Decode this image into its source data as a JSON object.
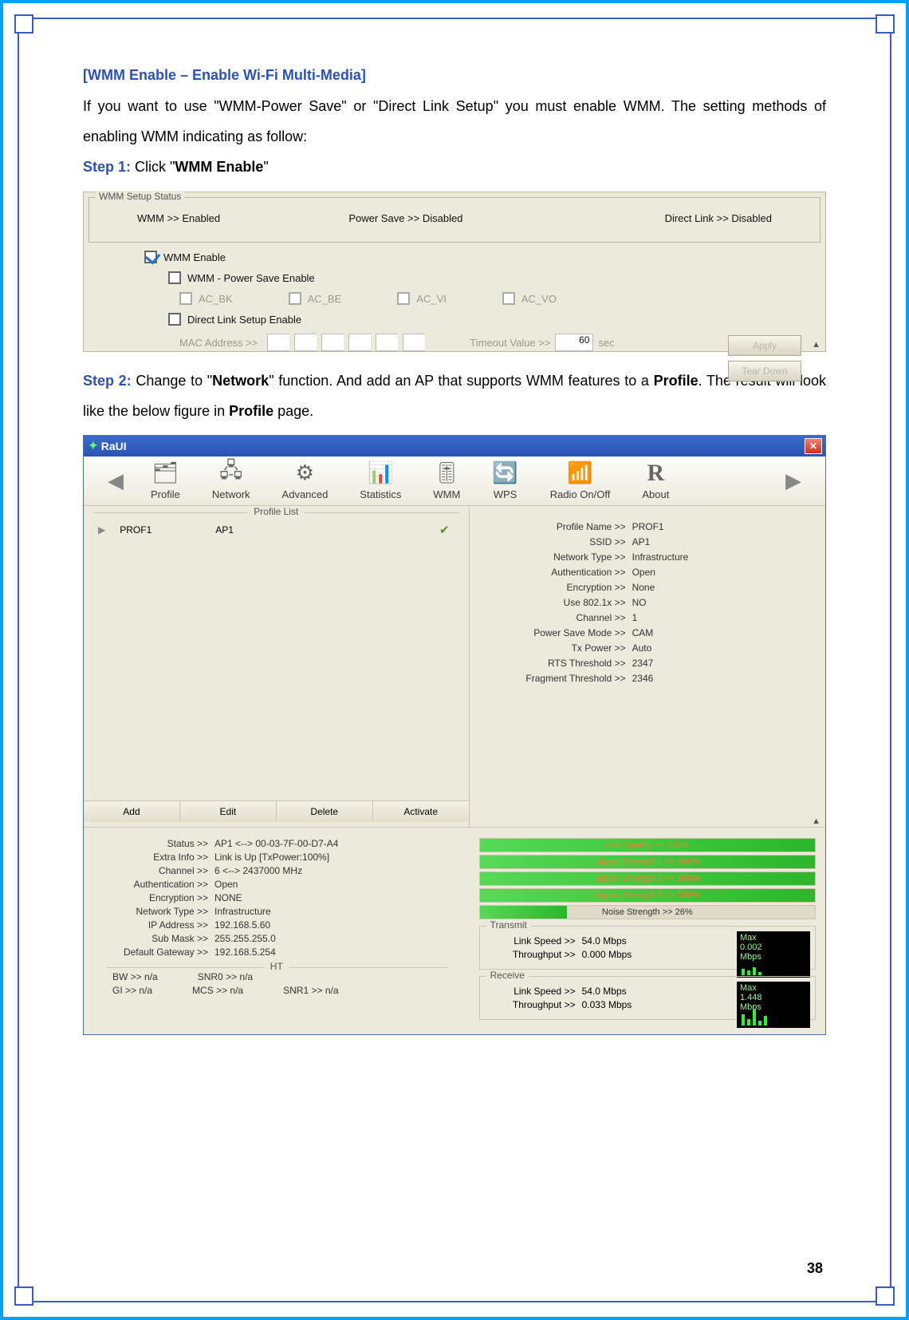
{
  "page_number": "38",
  "title": "[WMM Enable – Enable Wi-Fi Multi-Media]",
  "intro": "If you want to use \"WMM-Power Save\" or \"Direct Link Setup\" you must enable WMM. The setting methods of enabling WMM indicating as follow:",
  "step1_label": "Step 1: ",
  "step1_pre": "Click \"",
  "step1_bold": "WMM Enable",
  "step1_post": "\"",
  "step2_label": "Step 2: ",
  "step2_pre": "Change to \"",
  "step2_bold1": "Network",
  "step2_mid": "\" function. And add an AP that supports WMM features to a ",
  "step2_bold2": "Profile",
  "step2_mid2": ". The result will look like the below figure in ",
  "step2_bold3": "Profile",
  "step2_post": " page.",
  "wmm_panel": {
    "legend": "WMM Setup Status",
    "status_wmm": "WMM >>  Enabled",
    "status_power": "Power Save >>  Disabled",
    "status_dls": "Direct Link >>  Disabled",
    "cb_wmm": "WMM Enable",
    "cb_power": "WMM - Power Save Enable",
    "ac_bk": "AC_BK",
    "ac_be": "AC_BE",
    "ac_vi": "AC_VI",
    "ac_vo": "AC_VO",
    "cb_dls": "Direct Link Setup Enable",
    "mac_label": "MAC Address >>",
    "timeout_label": "Timeout Value >>",
    "timeout_value": "60",
    "timeout_unit": "sec",
    "btn_apply": "Apply",
    "btn_teardown": "Tear Down"
  },
  "raui": {
    "title": "RaUI",
    "tools": {
      "profile": "Profile",
      "network": "Network",
      "advanced": "Advanced",
      "statistics": "Statistics",
      "wmm": "WMM",
      "wps": "WPS",
      "radio": "Radio On/Off",
      "about": "About"
    },
    "profile_list_label": "Profile List",
    "profile_row": {
      "name": "PROF1",
      "ssid": "AP1"
    },
    "buttons": {
      "add": "Add",
      "edit": "Edit",
      "delete": "Delete",
      "activate": "Activate"
    },
    "detail": {
      "profile_name": {
        "k": "Profile Name >>",
        "v": "PROF1"
      },
      "ssid": {
        "k": "SSID >>",
        "v": "AP1"
      },
      "nettype": {
        "k": "Network Type >>",
        "v": "Infrastructure"
      },
      "auth": {
        "k": "Authentication >>",
        "v": "Open"
      },
      "enc": {
        "k": "Encryption >>",
        "v": "None"
      },
      "use8021x": {
        "k": "Use 802.1x >>",
        "v": "NO"
      },
      "channel": {
        "k": "Channel >>",
        "v": "1"
      },
      "powersave": {
        "k": "Power Save Mode >>",
        "v": "CAM"
      },
      "txpower": {
        "k": "Tx Power >>",
        "v": "Auto"
      },
      "rts": {
        "k": "RTS Threshold >>",
        "v": "2347"
      },
      "frag": {
        "k": "Fragment Threshold >>",
        "v": "2346"
      }
    },
    "status_left": {
      "status": {
        "k": "Status >>",
        "v": "AP1 <--> 00-03-7F-00-D7-A4"
      },
      "extra": {
        "k": "Extra Info >>",
        "v": "Link is Up [TxPower:100%]"
      },
      "channel": {
        "k": "Channel >>",
        "v": "6 <--> 2437000 MHz"
      },
      "auth": {
        "k": "Authentication >>",
        "v": "Open"
      },
      "enc": {
        "k": "Encryption >>",
        "v": "NONE"
      },
      "nettype": {
        "k": "Network Type >>",
        "v": "Infrastructure"
      },
      "ip": {
        "k": "IP Address >>",
        "v": "192.168.5.60"
      },
      "mask": {
        "k": "Sub Mask >>",
        "v": "255.255.255.0"
      },
      "gw": {
        "k": "Default Gateway >>",
        "v": "192.168.5.254"
      },
      "ht_label": "HT",
      "bw": {
        "k": "BW >>",
        "v": "n/a"
      },
      "snr0": {
        "k": "SNR0 >>",
        "v": "n/a"
      },
      "gi": {
        "k": "GI >>",
        "v": "n/a"
      },
      "mcs": {
        "k": "MCS >>",
        "v": "n/a"
      },
      "snr1": {
        "k": "SNR1 >>",
        "v": "n/a"
      }
    },
    "bars": {
      "lq": "Link Quality >> 100%",
      "ss1": "Signal Strength 1 >> 100%",
      "ss2": "Signal Strength 2 >> 100%",
      "ss3": "Signal Strength 3 >> 100%",
      "noise": "Noise Strength >> 26%"
    },
    "transmit": {
      "legend": "Transmit",
      "speed": {
        "k": "Link Speed >>",
        "v": "54.0 Mbps"
      },
      "tp": {
        "k": "Throughput >>",
        "v": "0.000 Mbps"
      },
      "gauge_top": "Max",
      "gauge_val": "0.002\nMbps"
    },
    "receive": {
      "legend": "Receive",
      "speed": {
        "k": "Link Speed >>",
        "v": "54.0 Mbps"
      },
      "tp": {
        "k": "Throughput >>",
        "v": "0.033 Mbps"
      },
      "gauge_top": "Max",
      "gauge_val": "1.448\nMbps"
    }
  }
}
